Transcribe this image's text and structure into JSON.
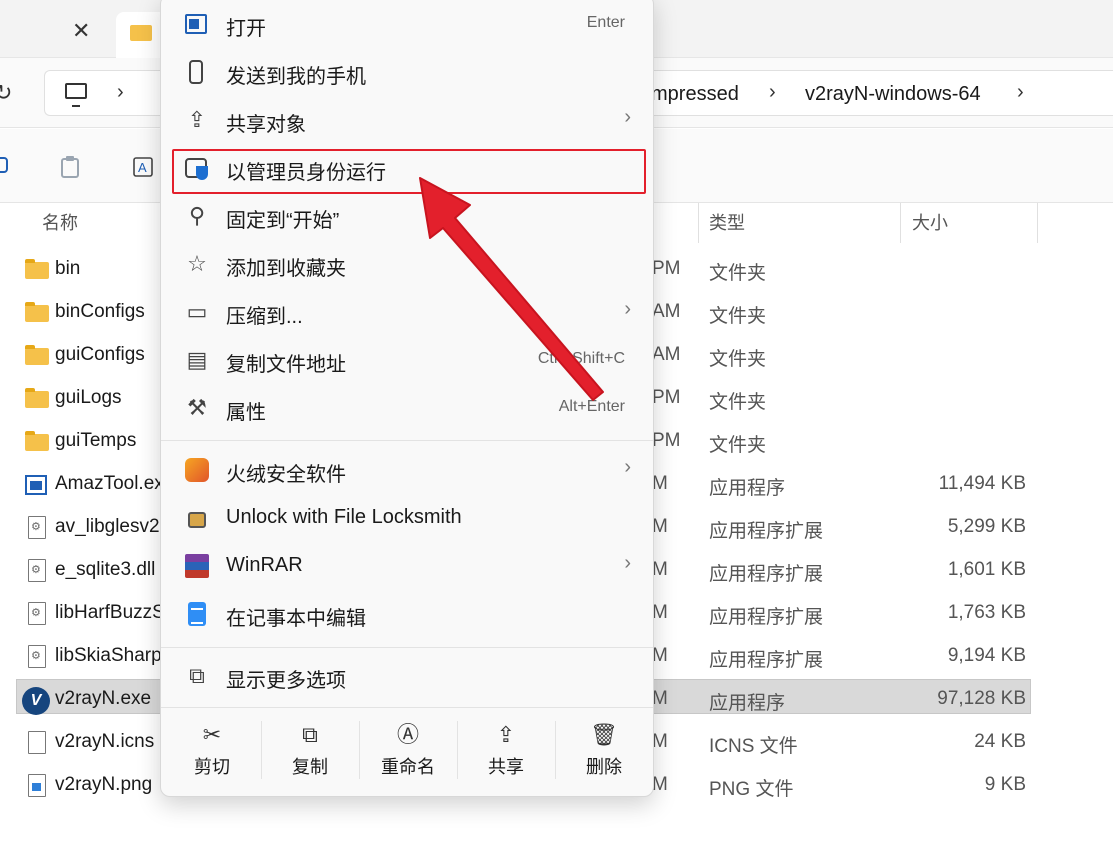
{
  "address": {
    "crumbs": [
      "mpressed",
      "v2rayN-windows-64"
    ]
  },
  "columns": {
    "name": "名称",
    "type": "类型",
    "size": "大小"
  },
  "files": [
    {
      "name": "bin",
      "time": "PM",
      "type": "文件夹",
      "size": "",
      "icon": "folder-icon"
    },
    {
      "name": "binConfigs",
      "time": "AM",
      "type": "文件夹",
      "size": "",
      "icon": "folder-icon"
    },
    {
      "name": "guiConfigs",
      "time": "AM",
      "type": "文件夹",
      "size": "",
      "icon": "folder-icon"
    },
    {
      "name": "guiLogs",
      "time": "PM",
      "type": "文件夹",
      "size": "",
      "icon": "folder-icon"
    },
    {
      "name": "guiTemps",
      "time": "PM",
      "type": "文件夹",
      "size": "",
      "icon": "folder-icon"
    },
    {
      "name": "AmazTool.ex",
      "time": "M",
      "type": "应用程序",
      "size": "11,494 KB",
      "icon": "exe-icon"
    },
    {
      "name": "av_libglesv2",
      "time": "M",
      "type": "应用程序扩展",
      "size": "5,299 KB",
      "icon": "dll-icon"
    },
    {
      "name": "e_sqlite3.dll",
      "time": "M",
      "type": "应用程序扩展",
      "size": "1,601 KB",
      "icon": "dll-icon"
    },
    {
      "name": "libHarfBuzzS",
      "time": "M",
      "type": "应用程序扩展",
      "size": "1,763 KB",
      "icon": "dll-icon"
    },
    {
      "name": "libSkiaSharp",
      "time": "M",
      "type": "应用程序扩展",
      "size": "9,194 KB",
      "icon": "dll-icon"
    },
    {
      "name": "v2rayN.exe",
      "time": "M",
      "type": "应用程序",
      "size": "97,128 KB",
      "icon": "v2rayn-icon",
      "selected": true
    },
    {
      "name": "v2rayN.icns",
      "time": "M",
      "type": "ICNS 文件",
      "size": "24 KB",
      "icon": "document-icon"
    },
    {
      "name": "v2rayN.png",
      "time": "M",
      "type": "PNG 文件",
      "size": "9 KB",
      "icon": "image-file-icon"
    }
  ],
  "menu": {
    "items": [
      {
        "label": "打开",
        "key": "Enter",
        "submenu": false,
        "icon": "open-app-icon"
      },
      {
        "label": "发送到我的手机",
        "key": "",
        "submenu": false,
        "icon": "phone-icon"
      },
      {
        "label": "共享对象",
        "key": "",
        "submenu": true,
        "icon": "share-icon"
      },
      {
        "label": "以管理员身份运行",
        "key": "",
        "submenu": false,
        "icon": "run-as-admin-shield-icon",
        "highlighted": true
      },
      {
        "label": "固定到“开始”",
        "key": "",
        "submenu": false,
        "icon": "pin-icon"
      },
      {
        "label": "添加到收藏夹",
        "key": "",
        "submenu": false,
        "icon": "star-icon"
      },
      {
        "label": "压缩到...",
        "key": "",
        "submenu": true,
        "icon": "compress-icon"
      },
      {
        "label": "复制文件地址",
        "key": "Ctrl+Shift+C",
        "submenu": false,
        "icon": "copy-path-icon"
      },
      {
        "label": "属性",
        "key": "Alt+Enter",
        "submenu": false,
        "icon": "wrench-icon"
      },
      {
        "label": "火绒安全软件",
        "key": "",
        "submenu": true,
        "icon": "huorong-icon"
      },
      {
        "label": "Unlock with File Locksmith",
        "key": "",
        "submenu": false,
        "icon": "lock-icon"
      },
      {
        "label": "WinRAR",
        "key": "",
        "submenu": true,
        "icon": "winrar-icon"
      },
      {
        "label": "在记事本中编辑",
        "key": "",
        "submenu": false,
        "icon": "notepad-icon"
      },
      {
        "label": "显示更多选项",
        "key": "",
        "submenu": false,
        "icon": "more-options-icon"
      }
    ],
    "actions": [
      {
        "label": "剪切",
        "glyph": "✂",
        "icon": "cut-icon"
      },
      {
        "label": "复制",
        "glyph": "⧉",
        "icon": "copy-icon"
      },
      {
        "label": "重命名",
        "glyph": "Ⓐ",
        "icon": "rename-icon"
      },
      {
        "label": "共享",
        "glyph": "⇪",
        "icon": "share-icon"
      },
      {
        "label": "删除",
        "glyph": "🗑",
        "icon": "delete-icon"
      }
    ],
    "submenu_glyph": "›"
  },
  "annotation": {
    "box_color": "#e3202c",
    "arrow_color": "#e3202c"
  }
}
